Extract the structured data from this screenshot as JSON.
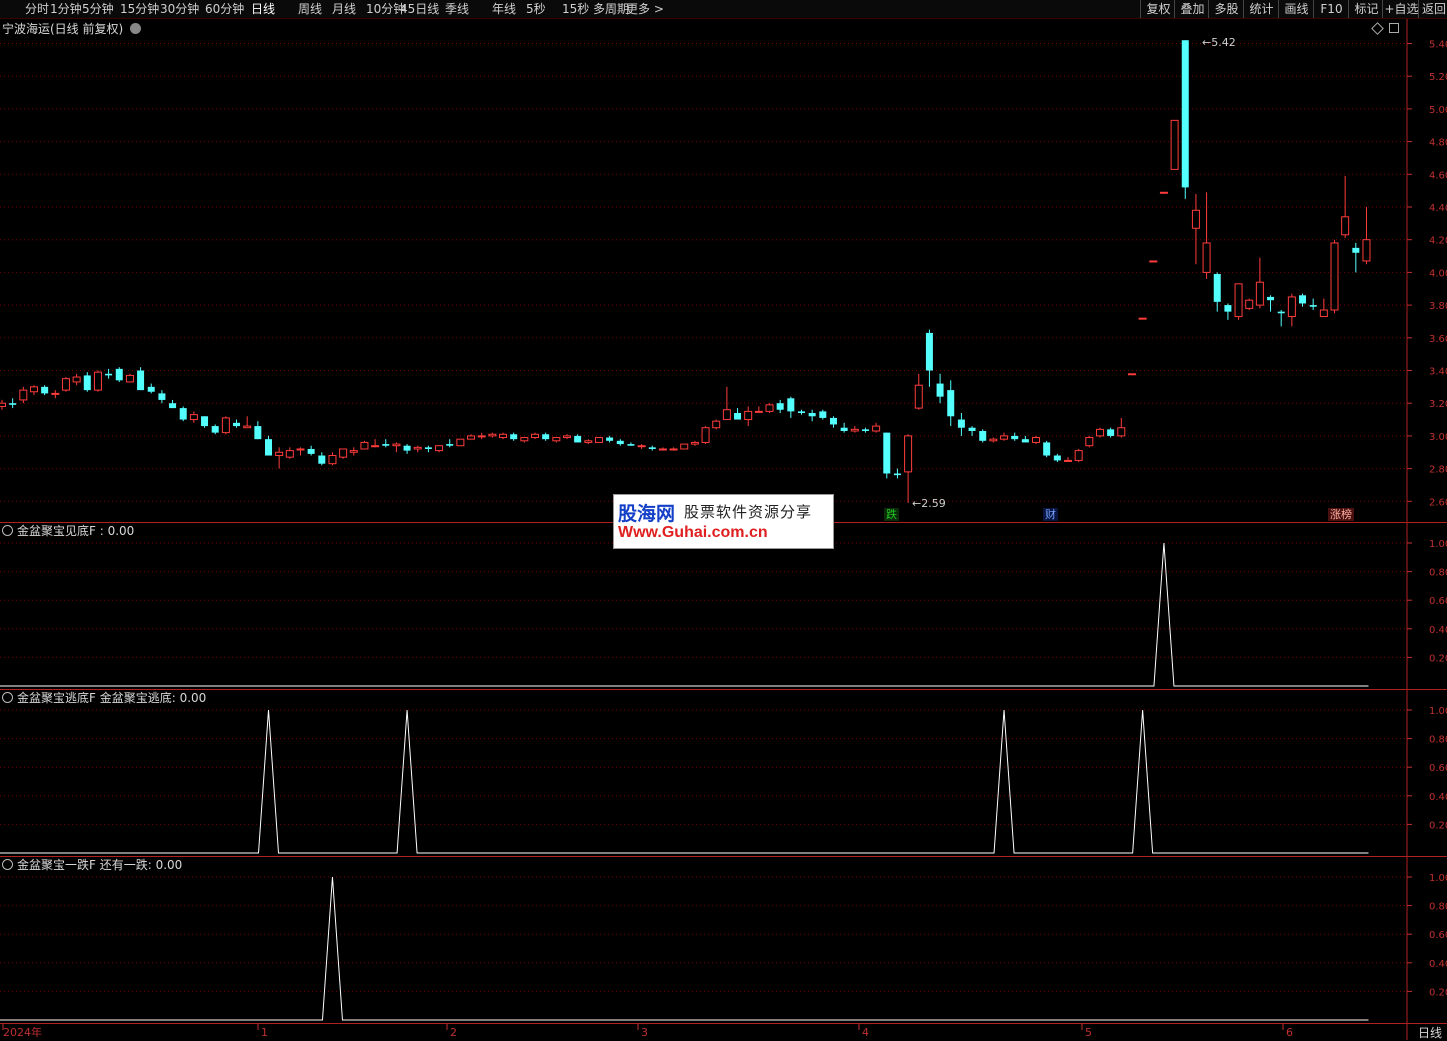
{
  "toolbar": {
    "periods": [
      "分时",
      "1分钟",
      "5分钟",
      "15分钟",
      "30分钟",
      "60分钟",
      "日线",
      "周线",
      "月线",
      "10分钟",
      "45日线",
      "季线",
      "年线",
      "5秒",
      "15秒",
      "多周期",
      "更多 >"
    ],
    "active_period": "日线",
    "right_tools": [
      "复权",
      "叠加",
      "多股",
      "统计",
      "画线",
      "F10",
      "标记",
      "+自选",
      "返回"
    ]
  },
  "main_chart": {
    "title": "宁波海运(日线 前复权)",
    "y_ticks": [
      "5.40",
      "5.20",
      "5.00",
      "4.80",
      "4.60",
      "4.40",
      "4.20",
      "4.00",
      "3.80",
      "3.60",
      "3.40",
      "3.20",
      "3.00",
      "2.80",
      "2.60"
    ],
    "high_label": "5.42",
    "low_label": "2.59",
    "tags": [
      {
        "text": "跌",
        "color": "#22c822",
        "bg": "#0a2a0a"
      },
      {
        "text": "财",
        "color": "#6fa0ff",
        "bg": "#0a1440"
      },
      {
        "text": "涨榜",
        "color": "#ffb0a0",
        "bg": "#4a1010"
      }
    ],
    "up_color": "#ff3c3c",
    "down_color": "#54ffff",
    "gridline_color": "#7a0000"
  },
  "indicators": [
    {
      "title": "金盆聚宝见底F : 0.00",
      "y_ticks": [
        "1.00",
        "0.80",
        "0.60",
        "0.40",
        "0.20"
      ]
    },
    {
      "title": "金盆聚宝逃底F  金盆聚宝逃底: 0.00",
      "y_ticks": [
        "1.00",
        "0.80",
        "0.60",
        "0.40",
        "0.20"
      ]
    },
    {
      "title": "金盆聚宝一跌F  还有一跌: 0.00",
      "y_ticks": [
        "1.00",
        "0.80",
        "0.60",
        "0.40",
        "0.20"
      ]
    }
  ],
  "x_axis": {
    "labels": [
      "2024年",
      "1",
      "2",
      "3",
      "4",
      "5",
      "6"
    ],
    "period_label": "日线"
  },
  "watermark": {
    "brand": "股海网",
    "slogan": "股票软件资源分享",
    "url": "Www.Guhai.com.cn"
  },
  "chart_data": {
    "type": "candlestick",
    "price_candles_ohlc": [
      [
        3.18,
        3.22,
        3.16,
        3.2
      ],
      [
        3.2,
        3.23,
        3.17,
        3.19
      ],
      [
        3.22,
        3.3,
        3.2,
        3.28
      ],
      [
        3.27,
        3.31,
        3.25,
        3.3
      ],
      [
        3.3,
        3.31,
        3.25,
        3.26
      ],
      [
        3.26,
        3.28,
        3.23,
        3.26
      ],
      [
        3.28,
        3.36,
        3.27,
        3.35
      ],
      [
        3.33,
        3.38,
        3.31,
        3.36
      ],
      [
        3.37,
        3.39,
        3.27,
        3.28
      ],
      [
        3.28,
        3.4,
        3.27,
        3.39
      ],
      [
        3.38,
        3.41,
        3.35,
        3.37
      ],
      [
        3.41,
        3.42,
        3.33,
        3.34
      ],
      [
        3.33,
        3.38,
        3.33,
        3.37
      ],
      [
        3.4,
        3.42,
        3.28,
        3.28
      ],
      [
        3.3,
        3.32,
        3.26,
        3.27
      ],
      [
        3.26,
        3.28,
        3.2,
        3.22
      ],
      [
        3.2,
        3.22,
        3.17,
        3.17
      ],
      [
        3.17,
        3.18,
        3.09,
        3.1
      ],
      [
        3.1,
        3.15,
        3.08,
        3.13
      ],
      [
        3.12,
        3.12,
        3.05,
        3.06
      ],
      [
        3.06,
        3.07,
        3.01,
        3.02
      ],
      [
        3.02,
        3.12,
        3.01,
        3.11
      ],
      [
        3.08,
        3.1,
        3.05,
        3.06
      ],
      [
        3.05,
        3.12,
        3.05,
        3.06
      ],
      [
        3.06,
        3.09,
        2.98,
        2.98
      ],
      [
        2.98,
        3.0,
        2.88,
        2.88
      ],
      [
        2.88,
        2.93,
        2.8,
        2.9
      ],
      [
        2.87,
        2.93,
        2.86,
        2.91
      ],
      [
        2.92,
        2.93,
        2.88,
        2.92
      ],
      [
        2.92,
        2.94,
        2.88,
        2.89
      ],
      [
        2.88,
        2.9,
        2.82,
        2.83
      ],
      [
        2.83,
        2.9,
        2.82,
        2.88
      ],
      [
        2.87,
        2.92,
        2.86,
        2.92
      ],
      [
        2.9,
        2.93,
        2.88,
        2.91
      ],
      [
        2.92,
        2.97,
        2.92,
        2.96
      ],
      [
        2.94,
        2.98,
        2.93,
        2.94
      ],
      [
        2.95,
        2.98,
        2.93,
        2.94
      ],
      [
        2.94,
        2.96,
        2.9,
        2.95
      ],
      [
        2.94,
        2.95,
        2.89,
        2.91
      ],
      [
        2.92,
        2.94,
        2.9,
        2.93
      ],
      [
        2.93,
        2.94,
        2.9,
        2.92
      ],
      [
        2.91,
        2.94,
        2.9,
        2.94
      ],
      [
        2.95,
        2.98,
        2.93,
        2.94
      ],
      [
        2.94,
        2.98,
        2.94,
        2.98
      ],
      [
        2.98,
        3.01,
        2.98,
        3.0
      ],
      [
        3.0,
        3.02,
        2.98,
        3.0
      ],
      [
        3.0,
        3.02,
        2.99,
        3.01
      ],
      [
        2.99,
        3.02,
        2.98,
        3.01
      ],
      [
        3.01,
        3.02,
        2.97,
        2.98
      ],
      [
        2.97,
        2.99,
        2.96,
        2.99
      ],
      [
        2.99,
        3.02,
        2.98,
        3.01
      ],
      [
        3.01,
        3.02,
        2.97,
        2.98
      ],
      [
        2.97,
        2.99,
        2.96,
        2.99
      ],
      [
        2.99,
        3.01,
        2.98,
        3.0
      ],
      [
        3.0,
        3.01,
        2.96,
        2.96
      ],
      [
        2.96,
        2.98,
        2.95,
        2.97
      ],
      [
        2.96,
        2.99,
        2.96,
        2.99
      ],
      [
        2.99,
        3.0,
        2.96,
        2.97
      ],
      [
        2.97,
        2.98,
        2.94,
        2.95
      ],
      [
        2.95,
        2.96,
        2.94,
        2.94
      ],
      [
        2.94,
        2.95,
        2.92,
        2.94
      ],
      [
        2.93,
        2.94,
        2.91,
        2.92
      ],
      [
        2.92,
        2.93,
        2.91,
        2.92
      ],
      [
        2.92,
        2.93,
        2.91,
        2.92
      ],
      [
        2.92,
        2.95,
        2.92,
        2.95
      ],
      [
        2.95,
        2.97,
        2.94,
        2.96
      ],
      [
        2.96,
        3.06,
        2.95,
        3.05
      ],
      [
        3.05,
        3.1,
        3.04,
        3.09
      ],
      [
        3.1,
        3.3,
        3.1,
        3.16
      ],
      [
        3.14,
        3.17,
        3.1,
        3.1
      ],
      [
        3.1,
        3.18,
        3.06,
        3.15
      ],
      [
        3.15,
        3.18,
        3.14,
        3.15
      ],
      [
        3.15,
        3.2,
        3.14,
        3.19
      ],
      [
        3.2,
        3.22,
        3.14,
        3.16
      ],
      [
        3.23,
        3.24,
        3.11,
        3.15
      ],
      [
        3.15,
        3.16,
        3.13,
        3.14
      ],
      [
        3.14,
        3.16,
        3.09,
        3.12
      ],
      [
        3.15,
        3.16,
        3.1,
        3.11
      ],
      [
        3.11,
        3.12,
        3.05,
        3.07
      ],
      [
        3.05,
        3.08,
        3.02,
        3.03
      ],
      [
        3.03,
        3.06,
        3.02,
        3.04
      ],
      [
        3.04,
        3.05,
        3.02,
        3.03
      ],
      [
        3.03,
        3.08,
        3.02,
        3.06
      ],
      [
        3.02,
        3.02,
        2.74,
        2.77
      ],
      [
        2.77,
        2.8,
        2.74,
        2.76
      ],
      [
        2.78,
        3.01,
        2.59,
        3.0
      ],
      [
        3.17,
        3.38,
        3.16,
        3.31
      ],
      [
        3.63,
        3.65,
        3.3,
        3.4
      ],
      [
        3.32,
        3.38,
        3.2,
        3.24
      ],
      [
        3.28,
        3.34,
        3.06,
        3.12
      ],
      [
        3.1,
        3.14,
        3.0,
        3.05
      ],
      [
        3.05,
        3.06,
        3.0,
        3.03
      ],
      [
        3.03,
        3.04,
        2.96,
        2.97
      ],
      [
        2.97,
        2.99,
        2.96,
        2.98
      ],
      [
        2.98,
        3.02,
        2.97,
        3.0
      ],
      [
        3.0,
        3.02,
        2.97,
        2.98
      ],
      [
        2.98,
        3.0,
        2.96,
        2.96
      ],
      [
        2.96,
        3.0,
        2.95,
        2.99
      ],
      [
        2.96,
        2.97,
        2.87,
        2.88
      ],
      [
        2.88,
        2.89,
        2.84,
        2.85
      ],
      [
        2.85,
        2.87,
        2.84,
        2.85
      ],
      [
        2.85,
        2.92,
        2.84,
        2.91
      ],
      [
        2.94,
        3.0,
        2.93,
        2.99
      ],
      [
        3.0,
        3.05,
        2.99,
        3.04
      ],
      [
        3.04,
        3.05,
        2.99,
        3.0
      ],
      [
        3.0,
        3.11,
        2.99,
        3.05
      ],
      [
        3.38,
        3.38,
        3.38,
        3.38
      ],
      [
        3.72,
        3.72,
        3.72,
        3.72
      ],
      [
        4.07,
        4.07,
        4.07,
        4.07
      ],
      [
        4.49,
        4.49,
        4.49,
        4.49
      ],
      [
        4.63,
        4.93,
        4.63,
        4.93
      ],
      [
        5.42,
        5.42,
        4.45,
        4.52
      ],
      [
        4.27,
        4.48,
        4.05,
        4.38
      ],
      [
        4.0,
        4.49,
        3.96,
        4.18
      ],
      [
        3.99,
        4.0,
        3.76,
        3.82
      ],
      [
        3.8,
        3.81,
        3.71,
        3.76
      ],
      [
        3.73,
        3.92,
        3.71,
        3.93
      ],
      [
        3.78,
        3.84,
        3.77,
        3.83
      ],
      [
        3.8,
        4.09,
        3.78,
        3.94
      ],
      [
        3.85,
        3.86,
        3.76,
        3.83
      ],
      [
        3.76,
        3.77,
        3.67,
        3.75
      ],
      [
        3.73,
        3.87,
        3.67,
        3.85
      ],
      [
        3.86,
        3.87,
        3.79,
        3.81
      ],
      [
        3.8,
        3.84,
        3.77,
        3.79
      ],
      [
        3.73,
        3.84,
        3.73,
        3.77
      ],
      [
        3.77,
        4.2,
        3.75,
        4.18
      ],
      [
        4.23,
        4.59,
        4.21,
        4.34
      ],
      [
        4.15,
        4.18,
        4.0,
        4.12
      ],
      [
        4.07,
        4.4,
        4.05,
        4.2
      ]
    ],
    "y_range": [
      2.55,
      5.5
    ],
    "high": 5.42,
    "low": 2.59,
    "signals": [
      {
        "name": "金盆聚宝见底",
        "x_index": [
          109
        ],
        "value": 1.0
      },
      {
        "name": "金盆聚宝逃底",
        "x_index": [
          25,
          38,
          94,
          107
        ],
        "value": 1.0
      },
      {
        "name": "金盆聚宝一跌",
        "x_index": [
          31
        ],
        "value": 1.0
      }
    ]
  }
}
